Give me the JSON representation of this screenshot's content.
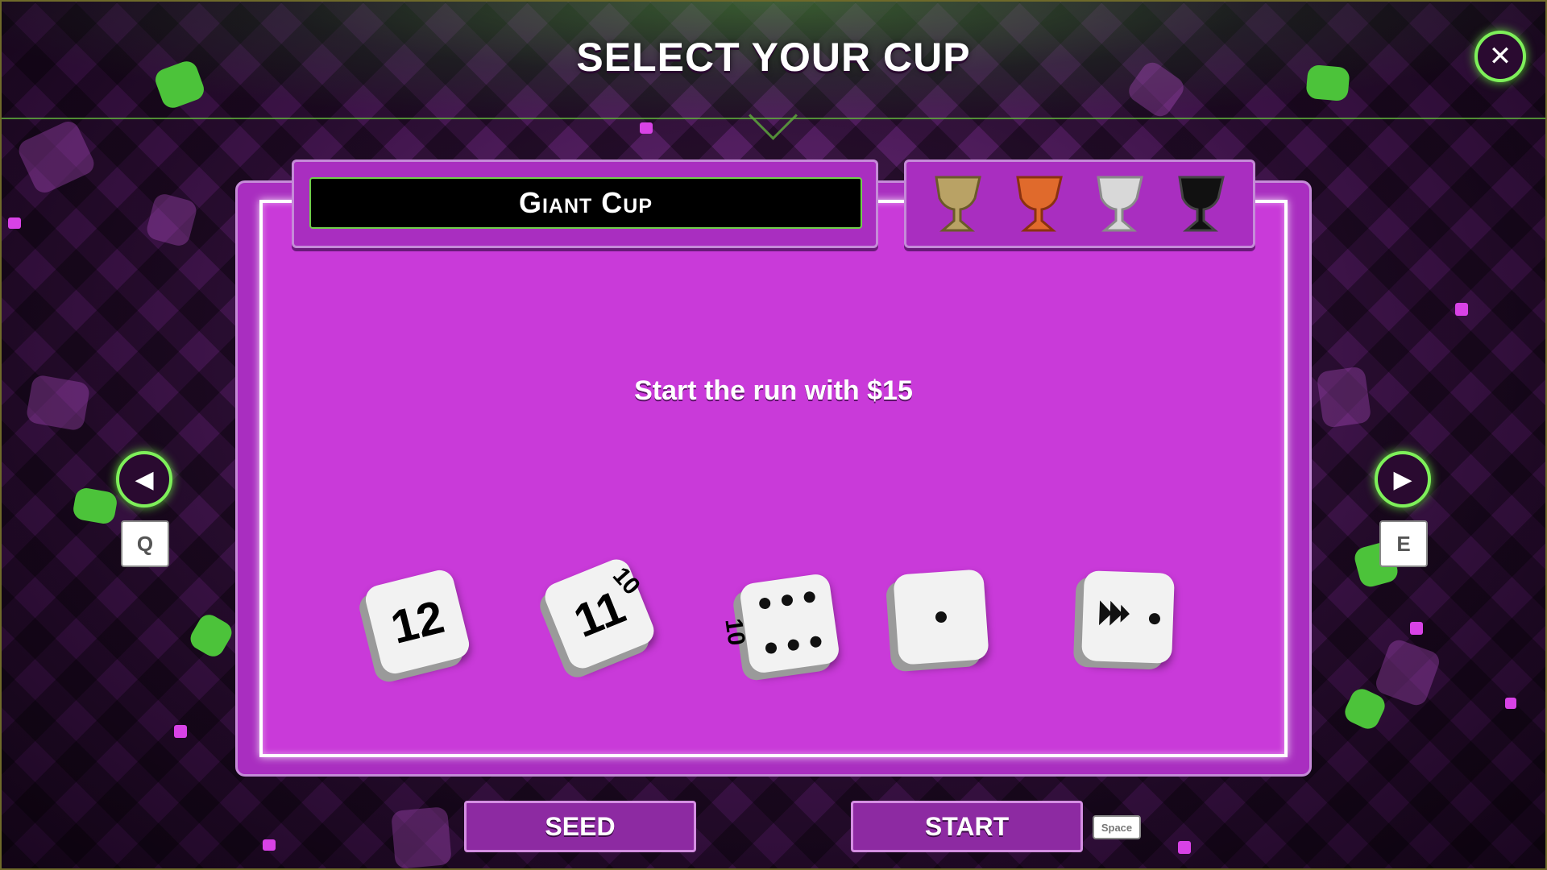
{
  "header": {
    "title": "SELECT YOUR CUP",
    "close_icon": "close-icon"
  },
  "cup": {
    "name": "Giant Cup",
    "description": "Start the run with $15",
    "trophies": [
      {
        "name": "gold-cup-icon",
        "color": "#b9a265"
      },
      {
        "name": "bronze-cup-icon",
        "color": "#e06a2c"
      },
      {
        "name": "silver-cup-icon",
        "color": "#d8d8d8"
      },
      {
        "name": "black-cup-icon",
        "color": "#111111"
      }
    ],
    "dice": [
      {
        "name": "die-d12",
        "face": "12"
      },
      {
        "name": "die-d11",
        "face": "11",
        "side": "10"
      },
      {
        "name": "die-d10",
        "face_pips": 6,
        "side": "10"
      },
      {
        "name": "die-one-pip",
        "face_pips": 1
      },
      {
        "name": "die-arrow",
        "face_pips": 1
      }
    ]
  },
  "nav": {
    "prev_key": "Q",
    "next_key": "E"
  },
  "buttons": {
    "seed_label": "SEED",
    "start_label": "START",
    "start_key": "Space"
  },
  "colors": {
    "accent_green": "#7ef05a",
    "panel_purple": "#c93ad9"
  }
}
